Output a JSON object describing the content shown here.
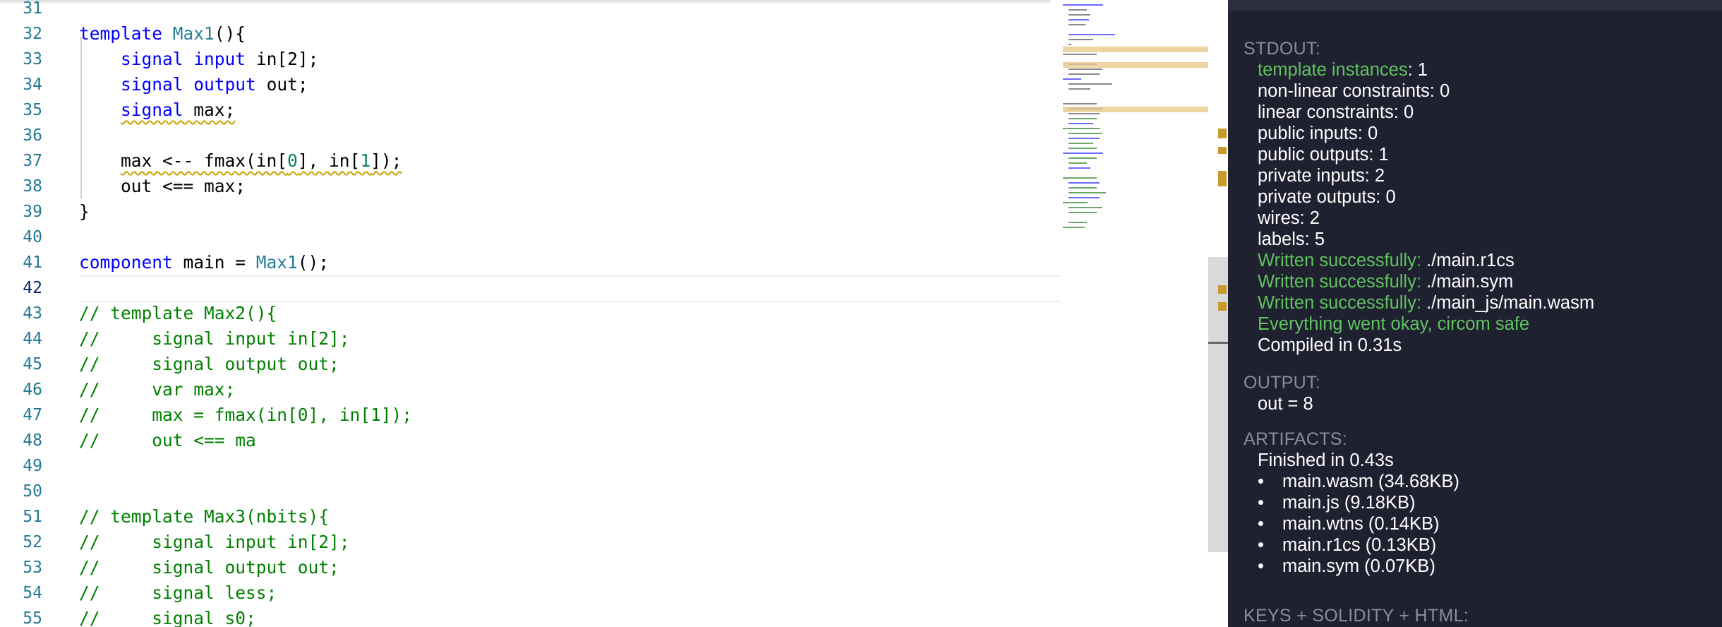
{
  "editor": {
    "lines": [
      {
        "n": "31",
        "t": [
          {
            "s": "",
            "c": ""
          }
        ]
      },
      {
        "n": "32",
        "t": [
          {
            "s": "template ",
            "c": "kw"
          },
          {
            "s": "Max1",
            "c": "ty"
          },
          {
            "s": "(){",
            "c": ""
          }
        ]
      },
      {
        "n": "33",
        "t": [
          {
            "s": "    ",
            "c": ""
          },
          {
            "s": "signal",
            "c": "kw"
          },
          {
            "s": " ",
            "c": ""
          },
          {
            "s": "input",
            "c": "kw"
          },
          {
            "s": " in[2];",
            "c": ""
          }
        ]
      },
      {
        "n": "34",
        "t": [
          {
            "s": "    ",
            "c": ""
          },
          {
            "s": "signal",
            "c": "kw"
          },
          {
            "s": " ",
            "c": ""
          },
          {
            "s": "output",
            "c": "kw"
          },
          {
            "s": " out;",
            "c": ""
          }
        ]
      },
      {
        "n": "35",
        "t": [
          {
            "s": "    ",
            "c": ""
          },
          {
            "s": "signal",
            "c": "kw squiggle"
          },
          {
            "s": " max;",
            "c": "squiggle"
          }
        ]
      },
      {
        "n": "36",
        "t": [
          {
            "s": "",
            "c": ""
          }
        ]
      },
      {
        "n": "37",
        "t": [
          {
            "s": "    ",
            "c": ""
          },
          {
            "s": "max <-- fmax(in[",
            "c": "squiggle"
          },
          {
            "s": "0",
            "c": "num squiggle"
          },
          {
            "s": "], in[",
            "c": "squiggle"
          },
          {
            "s": "1",
            "c": "num squiggle"
          },
          {
            "s": "]);",
            "c": "squiggle"
          }
        ]
      },
      {
        "n": "38",
        "t": [
          {
            "s": "    out <== max;",
            "c": ""
          }
        ]
      },
      {
        "n": "39",
        "t": [
          {
            "s": "}",
            "c": ""
          }
        ]
      },
      {
        "n": "40",
        "t": [
          {
            "s": "",
            "c": ""
          }
        ]
      },
      {
        "n": "41",
        "t": [
          {
            "s": "component",
            "c": "kw"
          },
          {
            "s": " main = ",
            "c": ""
          },
          {
            "s": "Max1",
            "c": "ty"
          },
          {
            "s": "();",
            "c": ""
          }
        ]
      },
      {
        "n": "42",
        "t": [
          {
            "s": "",
            "c": ""
          }
        ],
        "active": true
      },
      {
        "n": "43",
        "t": [
          {
            "s": "// template Max2(){",
            "c": "cm"
          }
        ]
      },
      {
        "n": "44",
        "t": [
          {
            "s": "//     signal input in[2];",
            "c": "cm"
          }
        ]
      },
      {
        "n": "45",
        "t": [
          {
            "s": "//     signal output out;",
            "c": "cm"
          }
        ]
      },
      {
        "n": "46",
        "t": [
          {
            "s": "//     var max;",
            "c": "cm"
          }
        ]
      },
      {
        "n": "47",
        "t": [
          {
            "s": "//     max = fmax(in[0], in[1]);",
            "c": "cm"
          }
        ]
      },
      {
        "n": "48",
        "t": [
          {
            "s": "//     out <== ma",
            "c": "cm"
          }
        ]
      },
      {
        "n": "49",
        "t": [
          {
            "s": "",
            "c": ""
          }
        ]
      },
      {
        "n": "50",
        "t": [
          {
            "s": "",
            "c": ""
          }
        ]
      },
      {
        "n": "51",
        "t": [
          {
            "s": "// template Max3(nbits){",
            "c": "cm"
          }
        ]
      },
      {
        "n": "52",
        "t": [
          {
            "s": "//     signal input in[2];",
            "c": "cm"
          }
        ]
      },
      {
        "n": "53",
        "t": [
          {
            "s": "//     signal output out;",
            "c": "cm"
          }
        ]
      },
      {
        "n": "54",
        "t": [
          {
            "s": "//     signal less;",
            "c": "cm"
          }
        ]
      },
      {
        "n": "55",
        "t": [
          {
            "s": "//     signal s0;",
            "c": "cm"
          }
        ]
      }
    ]
  },
  "panel": {
    "stdout_heading": "STDOUT:",
    "stdout": [
      {
        "label": "template instances",
        "sep": ": ",
        "value": "1",
        "green": true
      },
      {
        "label": "non-linear constraints",
        "sep": ": ",
        "value": "0",
        "green": false
      },
      {
        "label": "linear constraints",
        "sep": ": ",
        "value": "0",
        "green": false
      },
      {
        "label": "public inputs",
        "sep": ": ",
        "value": "0",
        "green": false
      },
      {
        "label": "public outputs",
        "sep": ": ",
        "value": "1",
        "green": false
      },
      {
        "label": "private inputs",
        "sep": ": ",
        "value": "2",
        "green": false
      },
      {
        "label": "private outputs",
        "sep": ": ",
        "value": "0",
        "green": false
      },
      {
        "label": "wires",
        "sep": ": ",
        "value": "2",
        "green": false
      },
      {
        "label": "labels",
        "sep": ": ",
        "value": "5",
        "green": false
      },
      {
        "label": "Written successfully:",
        "sep": " ",
        "value": "./main.r1cs",
        "green": true
      },
      {
        "label": "Written successfully:",
        "sep": " ",
        "value": "./main.sym",
        "green": true
      },
      {
        "label": "Written successfully:",
        "sep": " ",
        "value": "./main_js/main.wasm",
        "green": true
      },
      {
        "label": "Everything went okay, circom safe",
        "sep": "",
        "value": "",
        "green": true,
        "allgreen": true
      },
      {
        "label": "Compiled in 0.31s",
        "sep": "",
        "value": "",
        "green": false
      }
    ],
    "output_heading": "OUTPUT:",
    "output_value": "out = 8",
    "artifacts_heading": "ARTIFACTS:",
    "artifacts_finished": "Finished in 0.43s",
    "artifacts": [
      "main.wasm (34.68KB)",
      "main.js (9.18KB)",
      "main.wtns (0.14KB)",
      "main.r1cs (0.13KB)",
      "main.sym (0.07KB)"
    ],
    "keys_heading": "KEYS + SOLIDITY + HTML:"
  },
  "colors": {
    "keyword": "#0000ff",
    "type": "#267f99",
    "number": "#098658",
    "comment": "#008000",
    "panel_bg": "#1f2030",
    "success_green": "#5fc35f"
  }
}
